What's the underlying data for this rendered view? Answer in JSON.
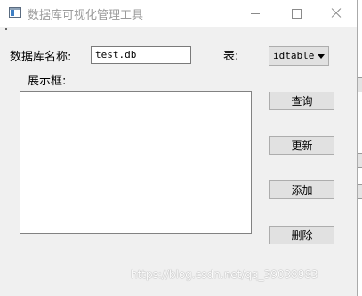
{
  "window": {
    "title": "数据库可视化管理工具",
    "icon": "app-window-icon"
  },
  "form": {
    "db_name_label": "数据库名称:",
    "db_name_value": "test.db",
    "table_label": "表:",
    "table_selected": "idtable",
    "display_label": "展示框:"
  },
  "buttons": {
    "query": "查询",
    "update": "更新",
    "add": "添加",
    "delete": "删除"
  },
  "watermark": "https://blog.csdn.net/qq_39038983",
  "colors": {
    "window_bg": "#f0f0f0",
    "button_bg": "#e1e1e1",
    "title_text": "#9a9a9a"
  }
}
